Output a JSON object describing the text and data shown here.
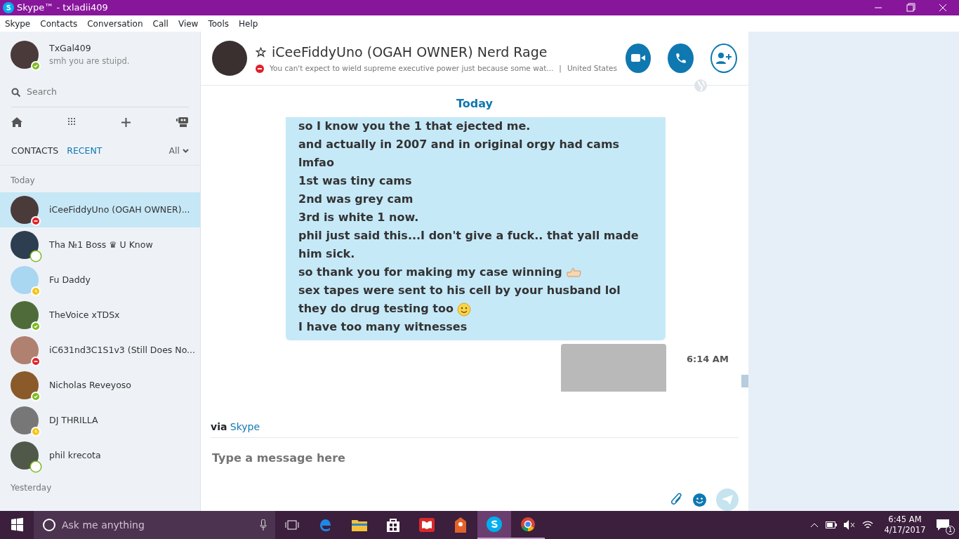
{
  "window": {
    "title": "Skype™ - txladii409"
  },
  "menu": [
    "Skype",
    "Contacts",
    "Conversation",
    "Call",
    "View",
    "Tools",
    "Help"
  ],
  "profile": {
    "name": "TxGal409",
    "mood": "smh you are stuipd.",
    "color": "#7cba1e"
  },
  "search": {
    "placeholder": "Search"
  },
  "tabs": [
    {
      "label": "CONTACTS",
      "selected": false
    },
    {
      "label": "RECENT",
      "selected": true
    }
  ],
  "filter": "All",
  "sections": [
    {
      "title": "Today",
      "contacts": [
        {
          "name": "iCeeFiddyUno (OGAH OWNER)...",
          "color": "#e0202a",
          "selected": true
        },
        {
          "name": "Tha №1 Boss ♛ U Know",
          "color": "#ffffff",
          "selected": false
        },
        {
          "name": "Fu Daddy",
          "color": "#f5c518",
          "selected": false
        },
        {
          "name": "TheVoice xTDSx",
          "color": "#7cba1e",
          "selected": false
        },
        {
          "name": "iC631nd3C1S1v3 (Still Does No...",
          "color": "#e0202a",
          "selected": false
        },
        {
          "name": "Nicholas Reveyoso",
          "color": "#7cba1e",
          "selected": false
        },
        {
          "name": "DJ THRILLA",
          "color": "#f5c518",
          "selected": false
        },
        {
          "name": "phil krecota",
          "color": "#ffffff",
          "selected": false
        }
      ]
    },
    {
      "title": "Yesterday"
    }
  ],
  "conversation": {
    "name": "iCeeFiddyUno (OGAH OWNER) Nerd Rage",
    "color": "#e0202a",
    "mood": "You can't expect to wield supreme executive power just because some wat...",
    "separator": "|",
    "location": "United States",
    "day": "Today",
    "messages": [
      {
        "kind": "plain",
        "text": "so I know you the 1 that ejected me."
      },
      {
        "kind": "plain",
        "text": "and actually in 2007 and in original orgy had cams"
      },
      {
        "kind": "plain",
        "text": "lmfao"
      },
      {
        "kind": "plain",
        "text": "1st was tiny cams"
      },
      {
        "kind": "plain",
        "text": "2nd was grey cam"
      },
      {
        "kind": "plain",
        "text": "3rd is white 1 now."
      },
      {
        "kind": "plain",
        "text": "phil just said this...I don't give a fuck.. that yall made him sick."
      },
      {
        "kind": "thumb",
        "text": "so thank you for making my case winning"
      },
      {
        "kind": "plain",
        "text": "sex tapes were sent to his cell by your husband lol"
      },
      {
        "kind": "smile",
        "text": "they do drug testing too"
      },
      {
        "kind": "plain",
        "text": "I have too many witnesses"
      }
    ],
    "attachment_time": "6:14 AM",
    "via_label": "via",
    "via_link": "Skype",
    "composer": {
      "placeholder": "Type a message here"
    }
  },
  "taskbar": {
    "search_placeholder": "Ask me anything",
    "time": "6:45 AM",
    "date": "4/17/2017",
    "notifications": "1"
  }
}
